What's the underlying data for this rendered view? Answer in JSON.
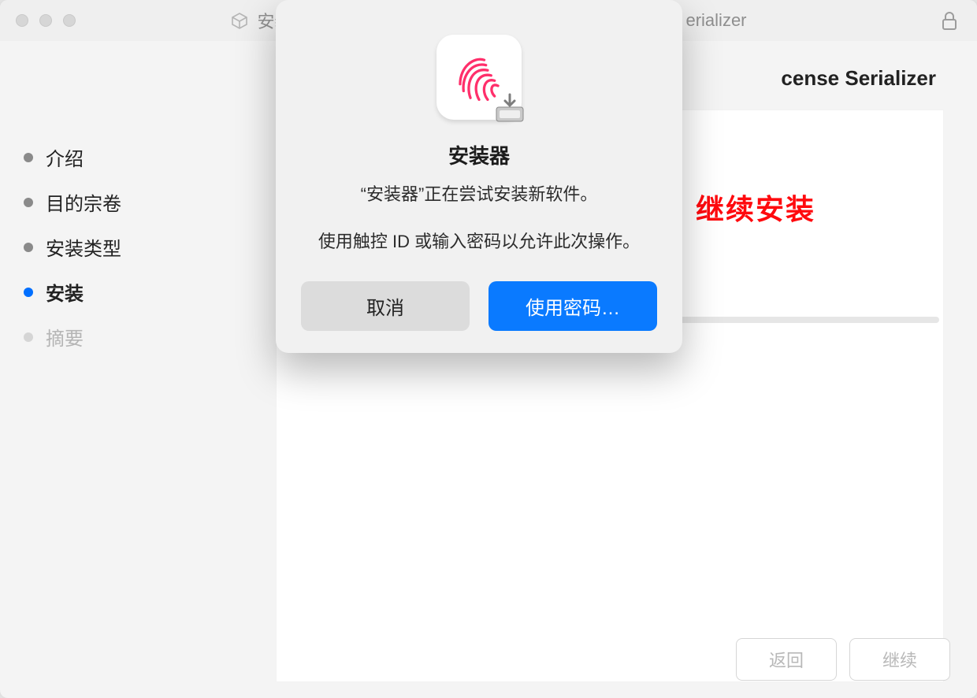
{
  "titlebar": {
    "prefix": "安装",
    "suffix": "erializer"
  },
  "sidebar": {
    "steps": [
      {
        "label": "介绍"
      },
      {
        "label": "目的宗卷"
      },
      {
        "label": "安装类型"
      },
      {
        "label": "安装"
      },
      {
        "label": "摘要"
      }
    ]
  },
  "main": {
    "title_suffix": "cense Serializer"
  },
  "bottom": {
    "back": "返回",
    "continue": "继续"
  },
  "annotation": "继续安装",
  "modal": {
    "title": "安装器",
    "line1": "“安装器”正在尝试安装新软件。",
    "line2": "使用触控 ID 或输入密码以允许此次操作。",
    "cancel": "取消",
    "use_password": "使用密码…"
  }
}
